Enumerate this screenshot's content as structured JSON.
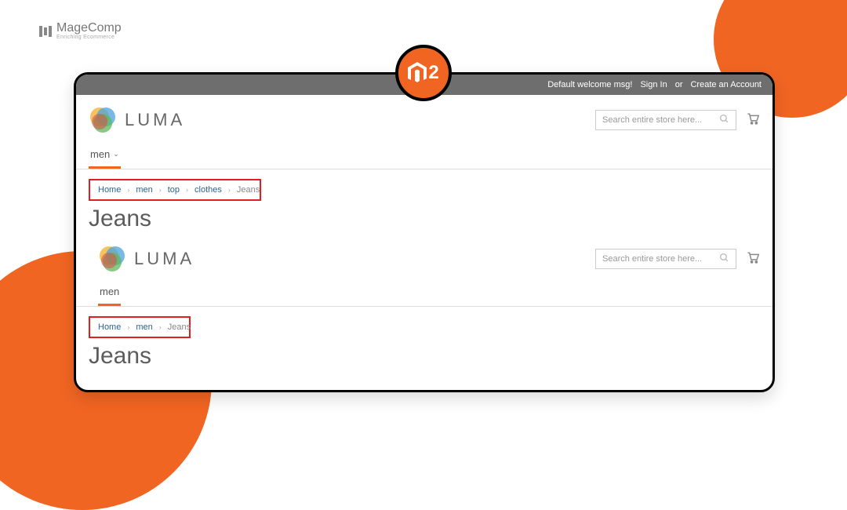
{
  "magecomp": {
    "name": "MageComp",
    "tagline": "Enriching Ecommerce"
  },
  "m2_badge": {
    "number": "2"
  },
  "topbar": {
    "welcome": "Default welcome msg!",
    "signin": "Sign In",
    "or": "or",
    "create": "Create an Account"
  },
  "luma": {
    "brand": "LUMA"
  },
  "search": {
    "placeholder": "Search entire store here..."
  },
  "nav": {
    "item": "men"
  },
  "section1": {
    "breadcrumbs": {
      "home": "Home",
      "men": "men",
      "top": "top",
      "clothes": "clothes",
      "jeans": "Jeans"
    },
    "title": "Jeans"
  },
  "section2": {
    "breadcrumbs": {
      "home": "Home",
      "men": "men",
      "jeans": "Jeans"
    },
    "title": "Jeans"
  }
}
